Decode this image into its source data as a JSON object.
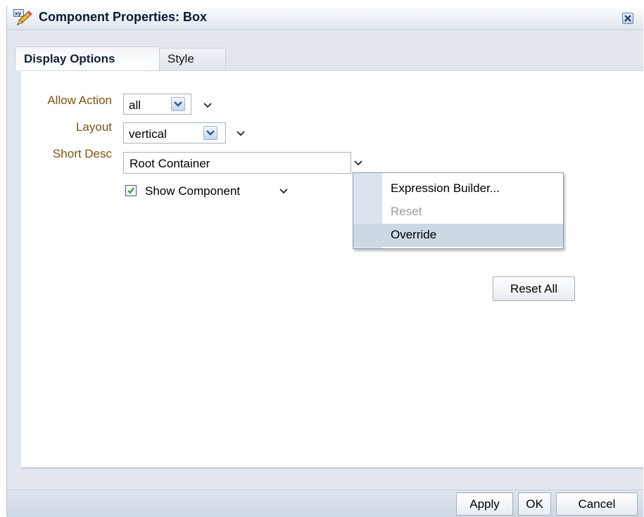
{
  "window": {
    "title": "Component Properties: Box",
    "title_icon": "xy-pencil-icon",
    "close_icon": "close-icon"
  },
  "tabs": [
    {
      "label": "Display Options",
      "active": true
    },
    {
      "label": "Style",
      "active": false
    }
  ],
  "fields": {
    "allow_action": {
      "label": "Allow Action",
      "value": "all"
    },
    "layout": {
      "label": "Layout",
      "value": "vertical"
    },
    "short_desc": {
      "label": "Short Desc",
      "value": "Root Container"
    },
    "show_component": {
      "label": "Show Component",
      "checked": true
    }
  },
  "context_menu": {
    "items": [
      {
        "label": "Expression Builder...",
        "enabled": true
      },
      {
        "label": "Reset",
        "enabled": false
      },
      {
        "label": "Override",
        "enabled": true,
        "highlighted": true
      }
    ]
  },
  "buttons": {
    "reset_all": "Reset All",
    "apply": "Apply",
    "ok": "OK",
    "cancel": "Cancel"
  },
  "colors": {
    "label_text": "#7a5412",
    "checkbox_check": "#2f9a2f",
    "menu_highlight": "#cdd8e5"
  }
}
